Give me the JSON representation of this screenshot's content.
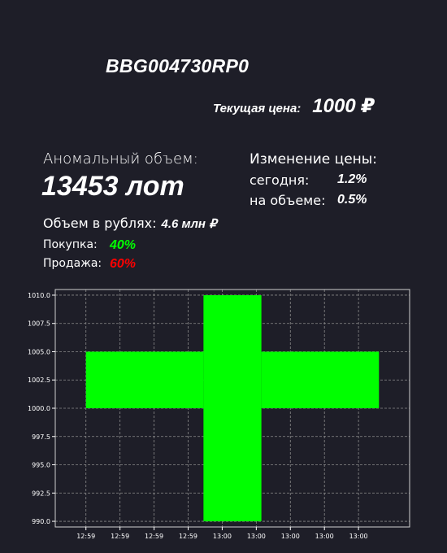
{
  "header": {
    "ticker": "BBG004730RP0",
    "price_label": "Текущая цена:",
    "price_value": "1000 ₽"
  },
  "volume": {
    "label": "Аномальный объем:",
    "value": "13453 лот",
    "rub_label": "Объем в рублях:",
    "rub_value": "4.6 млн ₽",
    "buy_label": "Покупка:",
    "buy_value": "40%",
    "sell_label": "Продажа:",
    "sell_value": "60%"
  },
  "price_change": {
    "title": "Изменение цены:",
    "today_label": "сегодня:",
    "today_value": "1.2%",
    "volume_label": "на объеме:",
    "volume_value": "0.5%"
  },
  "colors": {
    "background": "#1e1e28",
    "buy": "#00ff00",
    "sell": "#ff0000",
    "bar": "#00ff00",
    "grid": "#8a8a8a"
  },
  "chart_data": {
    "type": "bar",
    "grid": true,
    "ylim": [
      989.5,
      1010.5
    ],
    "yticks": [
      990.0,
      992.5,
      995.0,
      997.5,
      1000.0,
      1002.5,
      1005.0,
      1007.5,
      1010.0
    ],
    "ytick_labels": [
      "990.0",
      "992.5",
      "995.0",
      "997.5",
      "1000.0",
      "1002.5",
      "1005.0",
      "1007.5",
      "1010.0"
    ],
    "xtick_labels": [
      "12:59",
      "12:59",
      "12:59",
      "12:59",
      "13:00",
      "13:00",
      "13:00",
      "13:00",
      "13:00"
    ],
    "bars": [
      {
        "x_start": 0.0,
        "x_end": 3.45,
        "bottom": 1000.0,
        "top": 1005.0
      },
      {
        "x_start": 3.45,
        "x_end": 5.15,
        "bottom": 990.0,
        "top": 1010.0
      },
      {
        "x_start": 5.15,
        "x_end": 8.6,
        "bottom": 1000.0,
        "top": 1005.0
      }
    ]
  }
}
